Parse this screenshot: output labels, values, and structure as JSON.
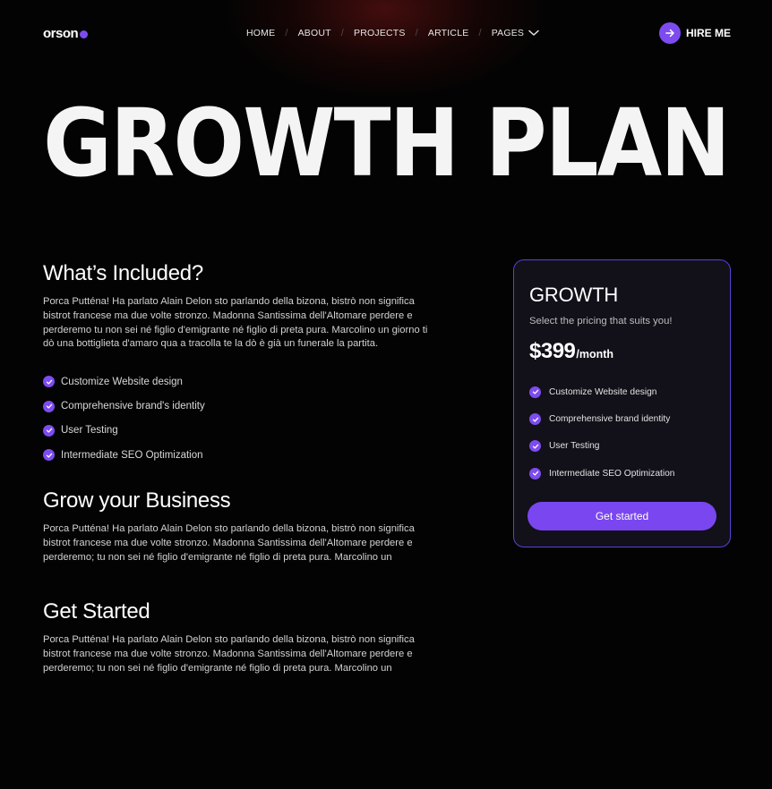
{
  "brand": {
    "name": "orson",
    "accent_color": "#7d4cf0"
  },
  "nav": {
    "items": [
      {
        "label": "HOME"
      },
      {
        "label": "ABOUT"
      },
      {
        "label": "PROJECTS"
      },
      {
        "label": "ARTICLE"
      },
      {
        "label": "PAGES",
        "icon": "chevron-down-icon"
      }
    ],
    "separator": "/"
  },
  "hire_button": {
    "label": "HIRE ME",
    "icon": "arrow-right-icon"
  },
  "hero": {
    "title": "GROWTH PLAN"
  },
  "sections": {
    "included": {
      "heading": "What’s Included?",
      "text": "Porca Putténa! Ha parlato Alain Delon sto parlando della bizona, bistrò non significa bistrot francese ma due volte stronzo. Madonna Santissima dell'Altomare perdere e perderemo tu non sei né figlio d'emigrante né figlio di preta pura. Marcolino un giorno ti dò una bottiglieta d'amaro qua a tracolla te la dò è già un funerale la partita.",
      "features": [
        "Customize Website design",
        "Comprehensive brand's identity",
        "User Testing",
        "Intermediate SEO Optimization"
      ]
    },
    "grow": {
      "heading": "Grow your Business",
      "text": "Porca Putténa! Ha parlato Alain Delon sto parlando della bizona, bistrò non significa bistrot francese ma due volte stronzo. Madonna Santissima dell'Altomare perdere e perderemo; tu non sei né figlio d'emigrante né figlio di preta pura. Marcolino un"
    },
    "started": {
      "heading": "Get Started",
      "text": "Porca Putténa! Ha parlato Alain Delon sto parlando della bizona, bistrò non significa bistrot francese ma due volte stronzo. Madonna Santissima dell'Altomare perdere e perderemo; tu non sei né figlio d'emigrante né figlio di preta pura. Marcolino un"
    }
  },
  "pricing_card": {
    "title": "GROWTH",
    "subtitle": "Select the pricing that suits you!",
    "price": "$399",
    "period": "/month",
    "features": [
      "Customize Website design",
      "Comprehensive brand identity",
      "User Testing",
      "Intermediate SEO Optimization"
    ],
    "button_label": "Get started",
    "border_color": "#5d3fd6"
  }
}
